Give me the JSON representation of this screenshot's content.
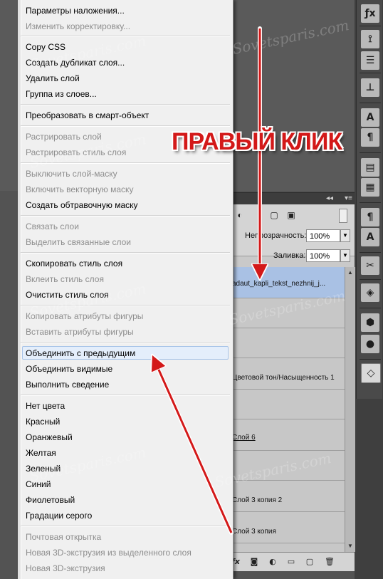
{
  "context_menu": {
    "items": [
      {
        "label": "Параметры наложения..."
      },
      {
        "label": "Изменить корректировку..."
      },
      {
        "label": "Copy CSS"
      },
      {
        "label": "Создать дубликат слоя..."
      },
      {
        "label": "Удалить слой"
      },
      {
        "label": "Группа из слоев..."
      },
      {
        "label": "Преобразовать в смарт-объект"
      },
      {
        "label": "Растрировать слой"
      },
      {
        "label": "Растрировать стиль слоя"
      },
      {
        "label": "Выключить слой-маску"
      },
      {
        "label": "Включить векторную маску"
      },
      {
        "label": "Создать обтравочную маску"
      },
      {
        "label": "Связать слои"
      },
      {
        "label": "Выделить связанные слои"
      },
      {
        "label": "Скопировать стиль слоя"
      },
      {
        "label": "Вклеить стиль слоя"
      },
      {
        "label": "Очистить стиль слоя"
      },
      {
        "label": "Копировать атрибуты фигуры"
      },
      {
        "label": "Вставить атрибуты фигуры"
      },
      {
        "label": "Объединить с предыдущим"
      },
      {
        "label": "Объединить видимые"
      },
      {
        "label": "Выполнить сведение"
      },
      {
        "label": "Нет цвета"
      },
      {
        "label": "Красный"
      },
      {
        "label": "Оранжевый"
      },
      {
        "label": "Желтая"
      },
      {
        "label": "Зеленый"
      },
      {
        "label": "Синий"
      },
      {
        "label": "Фиолетовый"
      },
      {
        "label": "Градации серого"
      },
      {
        "label": "Почтовая открытка"
      },
      {
        "label": "Новая 3D-экструзия из выделенного слоя"
      },
      {
        "label": "Новая 3D-экструзия"
      }
    ]
  },
  "annotation": {
    "callout_text": "ПРАВЫЙ КЛИК",
    "color": "#d31919"
  },
  "layers_panel": {
    "opacity_label": "Непрозрачность:",
    "opacity_value": "100%",
    "fill_label": "Заливка:",
    "fill_value": "100%",
    "layers": [
      {
        "name": "adaut_kapli_tekst_nezhnij_j..."
      },
      {
        "name": "Цветовой тон/Насыщенность 1"
      },
      {
        "name": "Слой 6"
      },
      {
        "name": "Слой 3 копия 2"
      },
      {
        "name": "Слой 3 копия"
      }
    ],
    "footer_fx": "fx"
  },
  "watermark": {
    "text": "Sovetsparis.com"
  }
}
